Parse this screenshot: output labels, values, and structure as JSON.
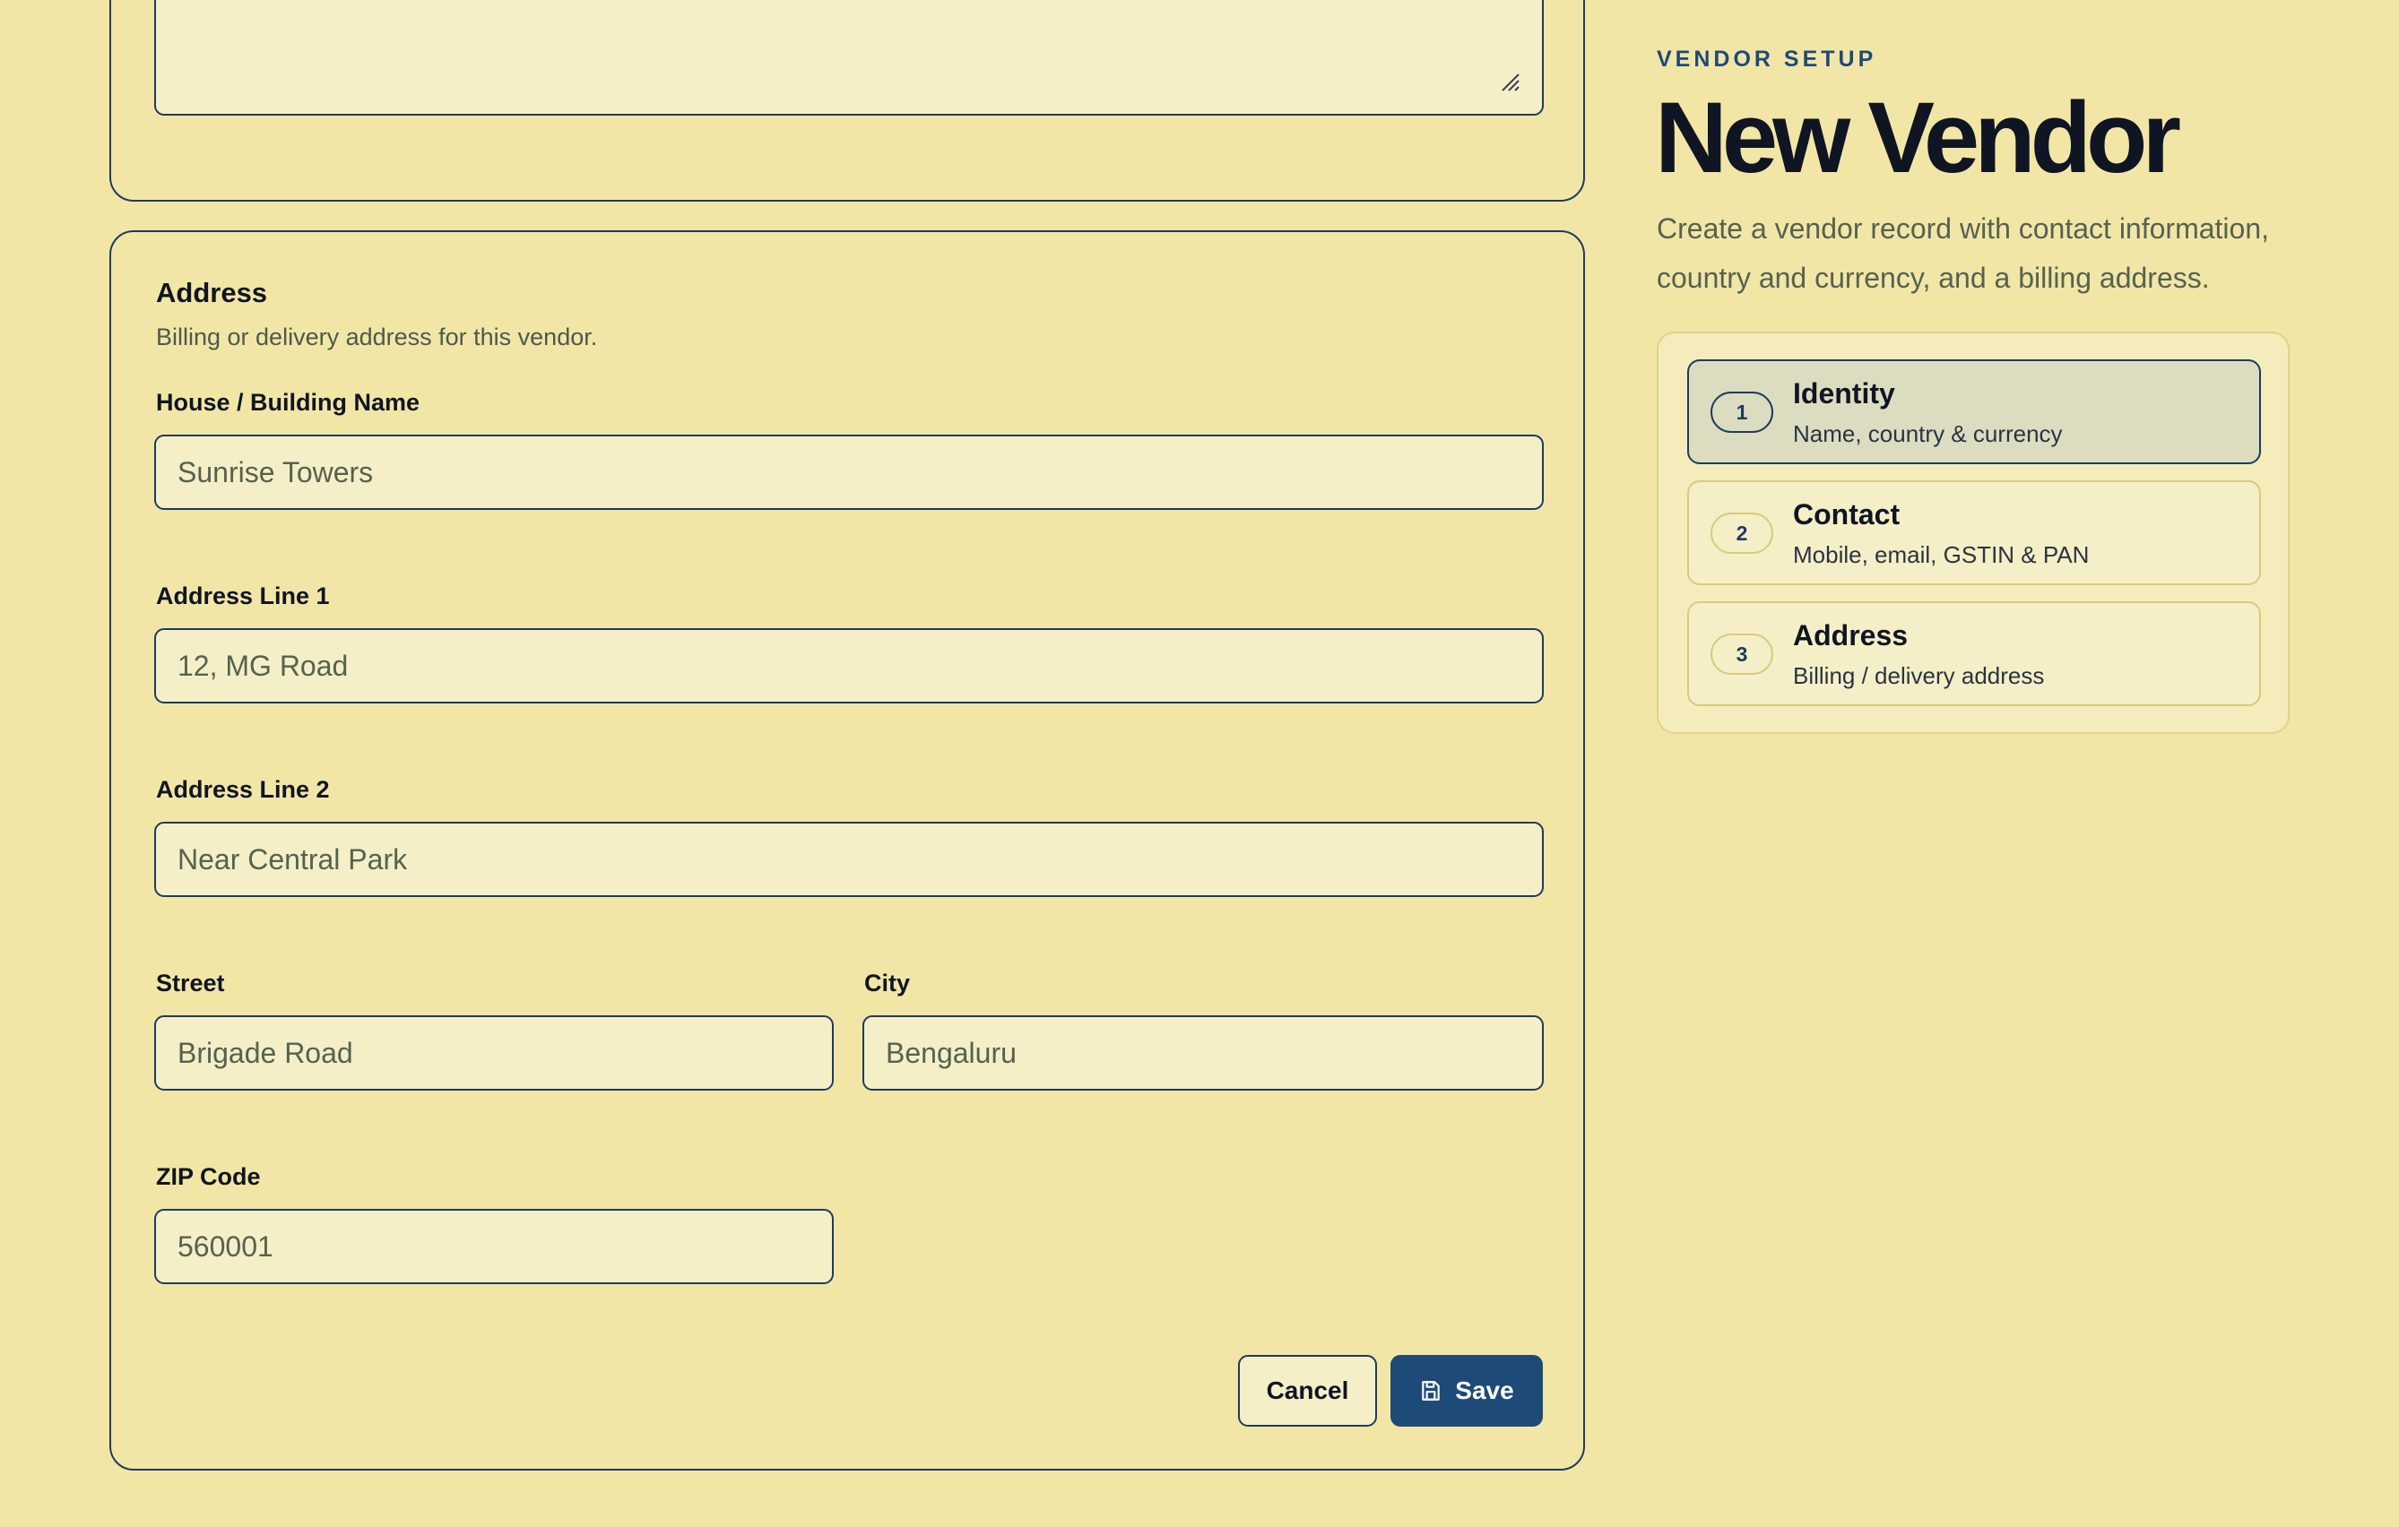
{
  "header": {
    "eyebrow": "VENDOR SETUP",
    "title": "New Vendor",
    "description": "Create a vendor record with contact information, country and currency, and a billing address."
  },
  "steps": [
    {
      "number": "1",
      "title": "Identity",
      "subtitle": "Name, country & currency",
      "active": true
    },
    {
      "number": "2",
      "title": "Contact",
      "subtitle": "Mobile, email, GSTIN & PAN",
      "active": false
    },
    {
      "number": "3",
      "title": "Address",
      "subtitle": "Billing / delivery address",
      "active": false
    }
  ],
  "address": {
    "title": "Address",
    "description": "Billing or delivery address for this vendor.",
    "fields": {
      "house": {
        "label": "House / Building Name",
        "placeholder": "Sunrise Towers"
      },
      "line1": {
        "label": "Address Line 1",
        "placeholder": "12, MG Road"
      },
      "line2": {
        "label": "Address Line 2",
        "placeholder": "Near Central Park"
      },
      "street": {
        "label": "Street",
        "placeholder": "Brigade Road"
      },
      "city": {
        "label": "City",
        "placeholder": "Bengaluru"
      },
      "zip": {
        "label": "ZIP Code",
        "placeholder": "560001"
      }
    }
  },
  "actions": {
    "cancel_label": "Cancel",
    "save_label": "Save"
  },
  "icons": {
    "save": "floppy-disk-icon",
    "resize": "resize-grip-icon"
  },
  "colors": {
    "background": "#f2e6a7",
    "accent": "#1e4a78",
    "input_bg": "#f5efc8"
  }
}
